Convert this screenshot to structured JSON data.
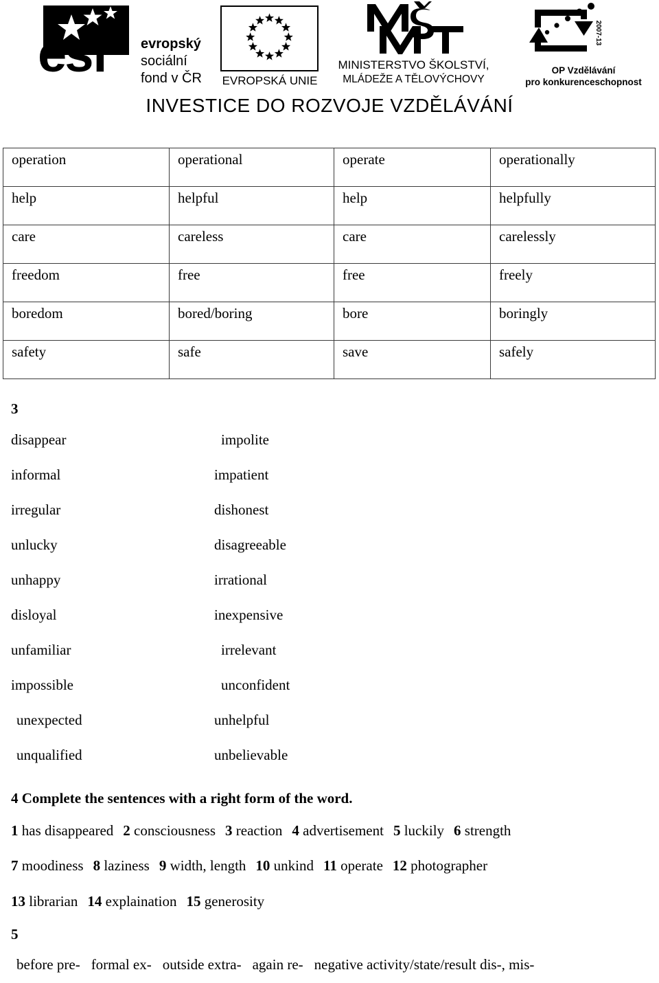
{
  "header": {
    "esf_logo": {
      "mark_text": "esf",
      "line1": "evropský",
      "line2": "sociální",
      "line3": "fond v ČR"
    },
    "eu_logo": {
      "caption": "EVROPSKÁ UNIE",
      "star_count": 12
    },
    "msmt_logo": {
      "mark_text": "MŠMT",
      "caption_line1": "MINISTERSTVO ŠKOLSTVÍ,",
      "caption_line2": "MLÁDEŽE A TĚLOVÝCHOVY"
    },
    "op_logo": {
      "year_text": "2007-13",
      "caption_line1": "OP Vzdělávání",
      "caption_line2": "pro konkurenceschopnost"
    },
    "tagline": "INVESTICE DO ROZVOJE VZDĚLÁVÁNÍ"
  },
  "word_table": {
    "rows": [
      [
        "operation",
        "operational",
        "operate",
        "operationally"
      ],
      [
        "help",
        "helpful",
        "help",
        "helpfully"
      ],
      [
        "care",
        "careless",
        "care",
        "carelessly"
      ],
      [
        "freedom",
        "free",
        "free",
        "freely"
      ],
      [
        "boredom",
        "bored/boring",
        "bore",
        "boringly"
      ],
      [
        "safety",
        "safe",
        "save",
        "safely"
      ]
    ]
  },
  "section3": {
    "number": "3",
    "pairs": [
      {
        "left": "disappear",
        "right": "impolite",
        "left_indent": false,
        "right_indent": true
      },
      {
        "left": "informal",
        "right": "impatient",
        "left_indent": false,
        "right_indent": false
      },
      {
        "left": "irregular",
        "right": "dishonest",
        "left_indent": false,
        "right_indent": false
      },
      {
        "left": "unlucky",
        "right": "disagreeable",
        "left_indent": false,
        "right_indent": false
      },
      {
        "left": "unhappy",
        "right": "irrational",
        "left_indent": false,
        "right_indent": false
      },
      {
        "left": "disloyal",
        "right": "inexpensive",
        "left_indent": false,
        "right_indent": false
      },
      {
        "left": "unfamiliar",
        "right": "irrelevant",
        "left_indent": false,
        "right_indent": true
      },
      {
        "left": "impossible",
        "right": "unconfident",
        "left_indent": false,
        "right_indent": true
      },
      {
        "left": "unexpected",
        "right": "unhelpful",
        "left_indent": true,
        "right_indent": false
      },
      {
        "left": "unqualified",
        "right": "unbelievable",
        "left_indent": true,
        "right_indent": false
      }
    ]
  },
  "section4": {
    "heading": "4 Complete the sentences with a right form of the word.",
    "answer_lines": [
      [
        {
          "num": "1",
          "text": "has disappeared"
        },
        {
          "num": "2",
          "text": "consciousness"
        },
        {
          "num": "3",
          "text": "reaction"
        },
        {
          "num": "4",
          "text": "advertisement"
        },
        {
          "num": "5",
          "text": "luckily"
        },
        {
          "num": "6",
          "text": "strength"
        }
      ],
      [
        {
          "num": "7",
          "text": "moodiness"
        },
        {
          "num": "8",
          "text": "laziness"
        },
        {
          "num": "9",
          "text": "width, length"
        },
        {
          "num": "10",
          "text": "unkind"
        },
        {
          "num": "11",
          "text": "operate"
        },
        {
          "num": "12",
          "text": "photographer"
        }
      ],
      [
        {
          "num": "13",
          "text": "librarian"
        },
        {
          "num": "14",
          "text": "explaination"
        },
        {
          "num": "15",
          "text": "generosity"
        }
      ]
    ]
  },
  "section5": {
    "number": "5",
    "items": [
      "before pre-",
      "formal ex-",
      "outside extra-",
      "again re-",
      "negative activity/state/result dis-, mis-"
    ]
  }
}
